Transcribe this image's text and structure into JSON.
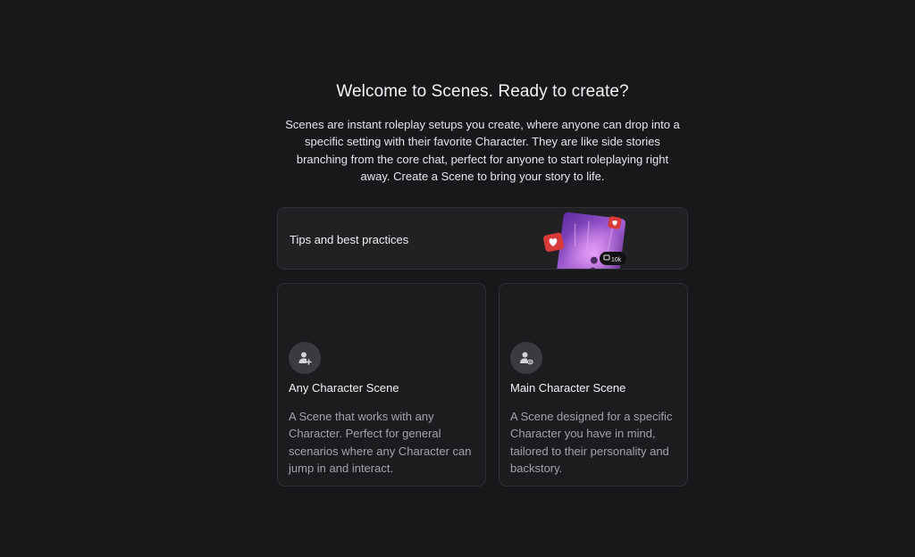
{
  "header": {
    "title": "Welcome to Scenes. Ready to create?",
    "description": "Scenes are instant roleplay setups you create, where anyone can drop into a specific setting with their favorite Character. They are like side stories branching from the core chat, perfect for anyone to start roleplaying right away. Create a Scene to bring your story to life."
  },
  "tips": {
    "label": "Tips and best practices",
    "comment_count": "10k",
    "heart_color": "#d83a3a",
    "art_colors": [
      "#6a2fa8",
      "#b36ad8",
      "#e58ae0"
    ]
  },
  "cards": [
    {
      "title": "Any Character Scene",
      "description": "A Scene that works with any Character. Perfect for general scenarios where any Character can jump in and interact.",
      "icon": "person-add-icon"
    },
    {
      "title": "Main Character Scene",
      "description": "A Scene designed for a specific Character you have in mind, tailored to their personality and backstory.",
      "icon": "person-link-icon"
    }
  ]
}
